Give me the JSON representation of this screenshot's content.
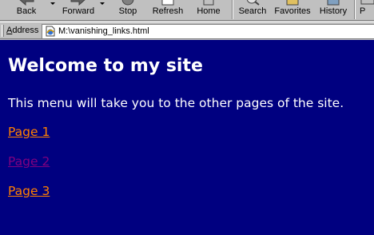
{
  "toolbar": {
    "back": "Back",
    "forward": "Forward",
    "stop": "Stop",
    "refresh": "Refresh",
    "home": "Home",
    "search": "Search",
    "favorites": "Favorites",
    "history": "History",
    "print": "P"
  },
  "address": {
    "label_accel": "A",
    "label_rest": "ddress",
    "url": "M:\\vanishing_links.html"
  },
  "page": {
    "title": "Welcome to my site",
    "intro": "This menu will take you to the other pages of the site.",
    "links": [
      {
        "label": "Page 1",
        "color": "#ff8000"
      },
      {
        "label": "Page 2",
        "color": "#800080"
      },
      {
        "label": "Page 3",
        "color": "#ff8000"
      }
    ]
  },
  "colors": {
    "page_background": "#000080",
    "text": "#ffffff",
    "chrome": "#c0c0c0"
  }
}
